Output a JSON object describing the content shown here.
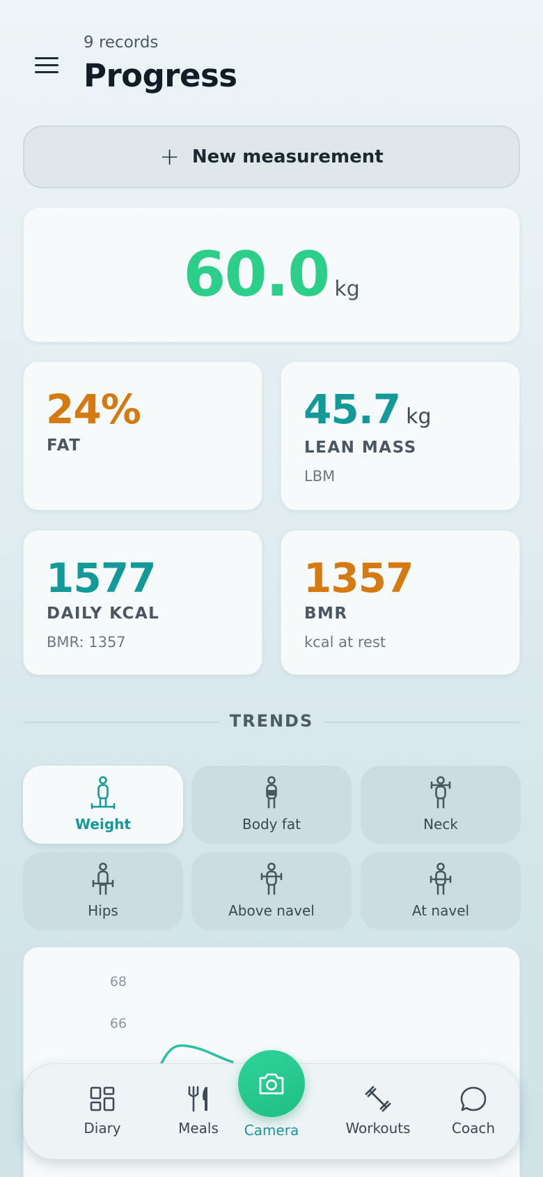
{
  "header": {
    "records": "9 records",
    "title": "Progress"
  },
  "actions": {
    "new_measurement": "New measurement"
  },
  "weight": {
    "value": "60.0",
    "unit": "kg"
  },
  "stats": {
    "fat": {
      "value": "24%",
      "label": "FAT"
    },
    "lean": {
      "value": "45.7",
      "unit": "kg",
      "label": "LEAN MASS",
      "sub": "LBM"
    },
    "kcal": {
      "value": "1577",
      "label": "DAILY KCAL",
      "sub": "BMR: 1357"
    },
    "bmr": {
      "value": "1357",
      "label": "BMR",
      "sub": "kcal at rest"
    }
  },
  "trends": {
    "heading": "TRENDS",
    "chips": [
      "Weight",
      "Body fat",
      "Neck",
      "Hips",
      "Above navel",
      "At navel"
    ],
    "active": "Weight"
  },
  "chart": {
    "ticks": [
      "68",
      "66"
    ]
  },
  "nav": {
    "diary": "Diary",
    "meals": "Meals",
    "camera": "Camera",
    "workouts": "Workouts",
    "coach": "Coach"
  },
  "colors": {
    "accent_green": "#2ccf8a",
    "accent_teal": "#139a98",
    "accent_orange": "#d47a10"
  }
}
